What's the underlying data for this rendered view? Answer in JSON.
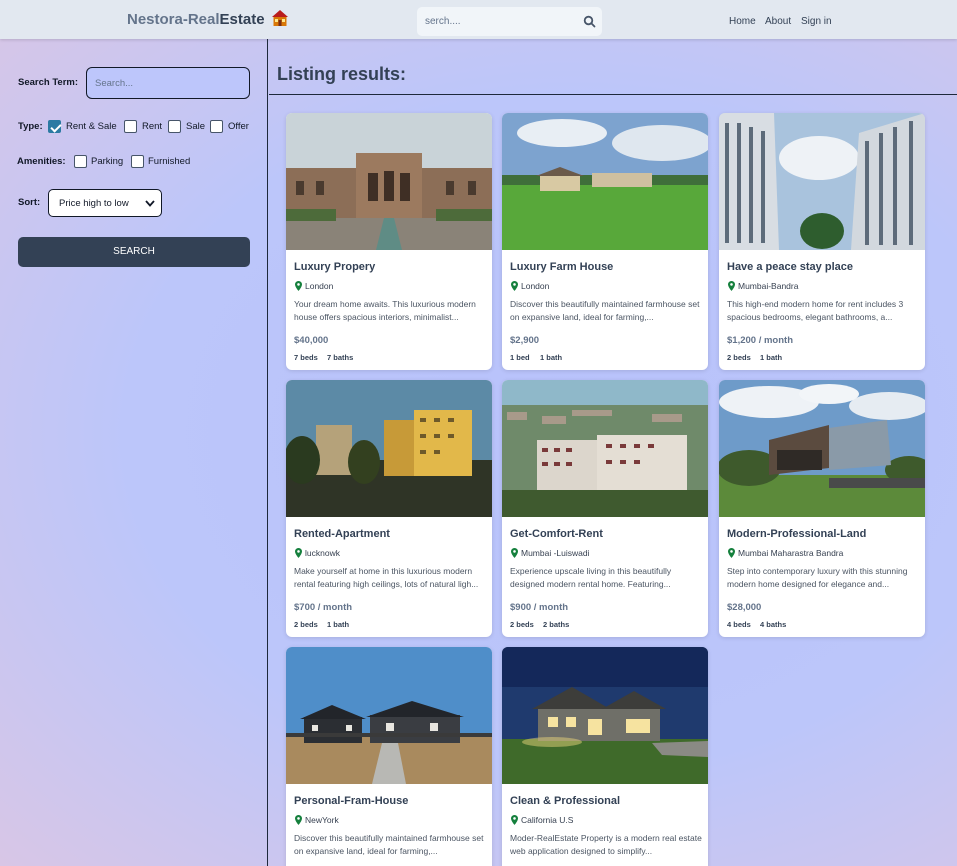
{
  "header": {
    "logo_part1": "Nestora-Real",
    "logo_part2": "Estate",
    "search_placeholder": "serch....",
    "nav": [
      "Home",
      "About",
      "Sign in"
    ]
  },
  "sidebar": {
    "search_term_label": "Search Term:",
    "search_term_placeholder": "Search...",
    "type_label": "Type:",
    "type_options": [
      {
        "label": "Rent & Sale",
        "checked": true
      },
      {
        "label": "Rent",
        "checked": false
      },
      {
        "label": "Sale",
        "checked": false
      },
      {
        "label": "Offer",
        "checked": false
      }
    ],
    "amenities_label": "Amenities:",
    "amenity_options": [
      {
        "label": "Parking",
        "checked": false
      },
      {
        "label": "Furnished",
        "checked": false
      }
    ],
    "sort_label": "Sort:",
    "sort_value": "Price high to low",
    "search_button": "SEARCH"
  },
  "main": {
    "title": "Listing results:",
    "listings": [
      {
        "name": "Luxury Propery",
        "location": "London",
        "description": "Your dream home awaits. This luxurious modern house offers spacious interiors, minimalist...",
        "price": "$40,000",
        "beds": "7 beds",
        "baths": "7 baths",
        "image": "palace"
      },
      {
        "name": "Luxury Farm House",
        "location": "London",
        "description": "Discover this beautifully maintained farmhouse set on expansive land, ideal for farming,...",
        "price": "$2,900",
        "beds": "1 bed",
        "baths": "1 bath",
        "image": "farm"
      },
      {
        "name": "Have a peace stay place",
        "location": "Mumbai-Bandra",
        "description": "This high-end modern home for rent includes 3 spacious bedrooms, elegant bathrooms, a...",
        "price": "$1,200 / month",
        "beds": "2 beds",
        "baths": "1 bath",
        "image": "towers"
      },
      {
        "name": "Rented-Apartment",
        "location": "lucknowk",
        "description": "Make yourself at home in this luxurious modern rental featuring high ceilings, lots of natural ligh...",
        "price": "$700 / month",
        "beds": "2 beds",
        "baths": "1 bath",
        "image": "apartment"
      },
      {
        "name": "Get-Comfort-Rent",
        "location": "Mumbai -Luiswadi",
        "description": "Experience upscale living in this beautifully designed modern rental home. Featuring...",
        "price": "$900 / month",
        "beds": "2 beds",
        "baths": "2 baths",
        "image": "city"
      },
      {
        "name": "Modern-Professional-Land",
        "location": "Mumbai Maharastra Bandra",
        "description": "Step into contemporary luxury with this stunning modern home designed for elegance and...",
        "price": "$28,000",
        "beds": "4 beds",
        "baths": "4 baths",
        "image": "modern"
      },
      {
        "name": "Personal-Fram-House",
        "location": "NewYork",
        "description": "Discover this beautifully maintained farmhouse set on expansive land, ideal for farming,...",
        "price": "",
        "beds": "",
        "baths": "",
        "image": "estate"
      },
      {
        "name": "Clean & Professional",
        "location": "California U.S",
        "description": "Moder-RealEstate Property is a modern real estate web application designed to simplify...",
        "price": "",
        "beds": "",
        "baths": "",
        "image": "night"
      }
    ]
  },
  "colors": {
    "header_bg": "#e2e8f0",
    "page_bg": "#bcc6fa",
    "button_bg": "#334155",
    "checkbox_checked": "#2b7aa3",
    "pin": "#15803d"
  }
}
